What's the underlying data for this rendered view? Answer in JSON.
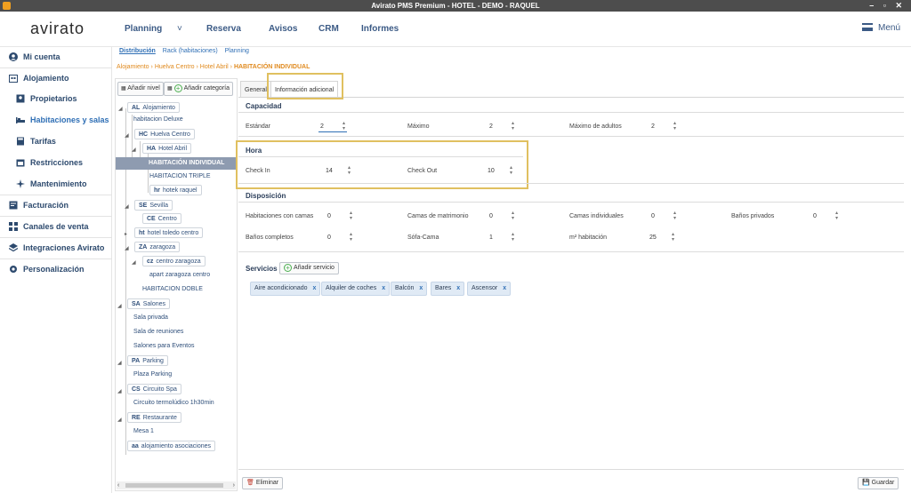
{
  "window": {
    "title": "Avirato PMS Premium - HOTEL - DEMO - RAQUEL",
    "controls": "– ▫ ✕"
  },
  "nav": {
    "logo": "avirato",
    "items": [
      "Planning",
      "Reserva",
      "Avisos",
      "CRM",
      "Informes"
    ],
    "menu": "Menú"
  },
  "sidebar": {
    "items": [
      {
        "label": "Mi cuenta",
        "icon": "user-icon"
      },
      {
        "label": "Alojamiento",
        "icon": "building-icon"
      },
      {
        "label": "Propietarios",
        "icon": "owner-icon"
      },
      {
        "label": "Habitaciones y salas",
        "icon": "bed-icon"
      },
      {
        "label": "Tarifas",
        "icon": "calculator-icon"
      },
      {
        "label": "Restricciones",
        "icon": "calendar-icon"
      },
      {
        "label": "Mantenimiento",
        "icon": "sparkle-icon"
      },
      {
        "label": "Facturación",
        "icon": "invoice-icon"
      },
      {
        "label": "Canales de venta",
        "icon": "grid-icon"
      },
      {
        "label": "Integraciones Avirato",
        "icon": "layers-icon"
      },
      {
        "label": "Personalización",
        "icon": "gear-icon"
      }
    ]
  },
  "subtabs": [
    "Distribución",
    "Rack (habitaciones)",
    "Planning"
  ],
  "breadcrumb": [
    "Alojamiento",
    "Huelva Centro",
    "Hotel Abril",
    "HABITACIÓN INDIVIDUAL"
  ],
  "tree": {
    "add_level": "Añadir nivel",
    "add_category": "Añadir categoría",
    "nodes": [
      {
        "code": "AL",
        "label": "Alojamiento"
      },
      {
        "code": "",
        "label": "habitacion Deluxe"
      },
      {
        "code": "HC",
        "label": "Huelva Centro"
      },
      {
        "code": "HA",
        "label": "Hotel Abril"
      },
      {
        "code": "",
        "label": "HABITACIÓN INDIVIDUAL"
      },
      {
        "code": "",
        "label": "HABITACION TRIPLE"
      },
      {
        "code": "hr",
        "label": "hotek raquel"
      },
      {
        "code": "SE",
        "label": "Sevilla"
      },
      {
        "code": "CE",
        "label": "Centro"
      },
      {
        "code": "ht",
        "label": "hotel toledo centro"
      },
      {
        "code": "ZA",
        "label": "zaragoza"
      },
      {
        "code": "cz",
        "label": "centro zaragoza"
      },
      {
        "code": "",
        "label": "apart zaragoza centro"
      },
      {
        "code": "",
        "label": "HABITACION DOBLE"
      },
      {
        "code": "SA",
        "label": "Salones"
      },
      {
        "code": "",
        "label": "Sala privada"
      },
      {
        "code": "",
        "label": "Sala de reuniones"
      },
      {
        "code": "",
        "label": "Salones para Eventos"
      },
      {
        "code": "PA",
        "label": "Parking"
      },
      {
        "code": "",
        "label": "Plaza Parking"
      },
      {
        "code": "CS",
        "label": "Circuito Spa"
      },
      {
        "code": "",
        "label": "Circuito termolúdico 1h30min"
      },
      {
        "code": "RE",
        "label": "Restaurante"
      },
      {
        "code": "",
        "label": "Mesa 1"
      },
      {
        "code": "aa",
        "label": "alojamiento asociaciones"
      }
    ]
  },
  "tabs": [
    "General",
    "Información adicional"
  ],
  "capacidad": {
    "title": "Capacidad",
    "estandar_label": "Estándar",
    "estandar": "2",
    "maximo_label": "Máximo",
    "maximo": "2",
    "max_adultos_label": "Máximo de adultos",
    "max_adultos": "2"
  },
  "hora": {
    "title": "Hora",
    "checkin_label": "Check In",
    "checkin": "14",
    "checkout_label": "Check Out",
    "checkout": "10"
  },
  "disposicion": {
    "title": "Disposición",
    "hab_camas_label": "Habitaciones con camas",
    "hab_camas": "0",
    "matrimonio_label": "Camas de matrimonio",
    "matrimonio": "0",
    "individuales_label": "Camas individuales",
    "individuales": "0",
    "banos_priv_label": "Baños privados",
    "banos_priv": "0",
    "banos_comp_label": "Baños completos",
    "banos_comp": "0",
    "sofa_label": "Sófa-Cama",
    "sofa": "1",
    "m2_label": "m² habitación",
    "m2": "25"
  },
  "servicios": {
    "title": "Servicios",
    "add_label": "Añadir servicio",
    "tags": [
      "Aire acondicionado",
      "Alquiler de coches",
      "Balcón",
      "Bares",
      "Ascensor"
    ]
  },
  "footer": {
    "delete": "Eliminar",
    "save": "Guardar"
  }
}
